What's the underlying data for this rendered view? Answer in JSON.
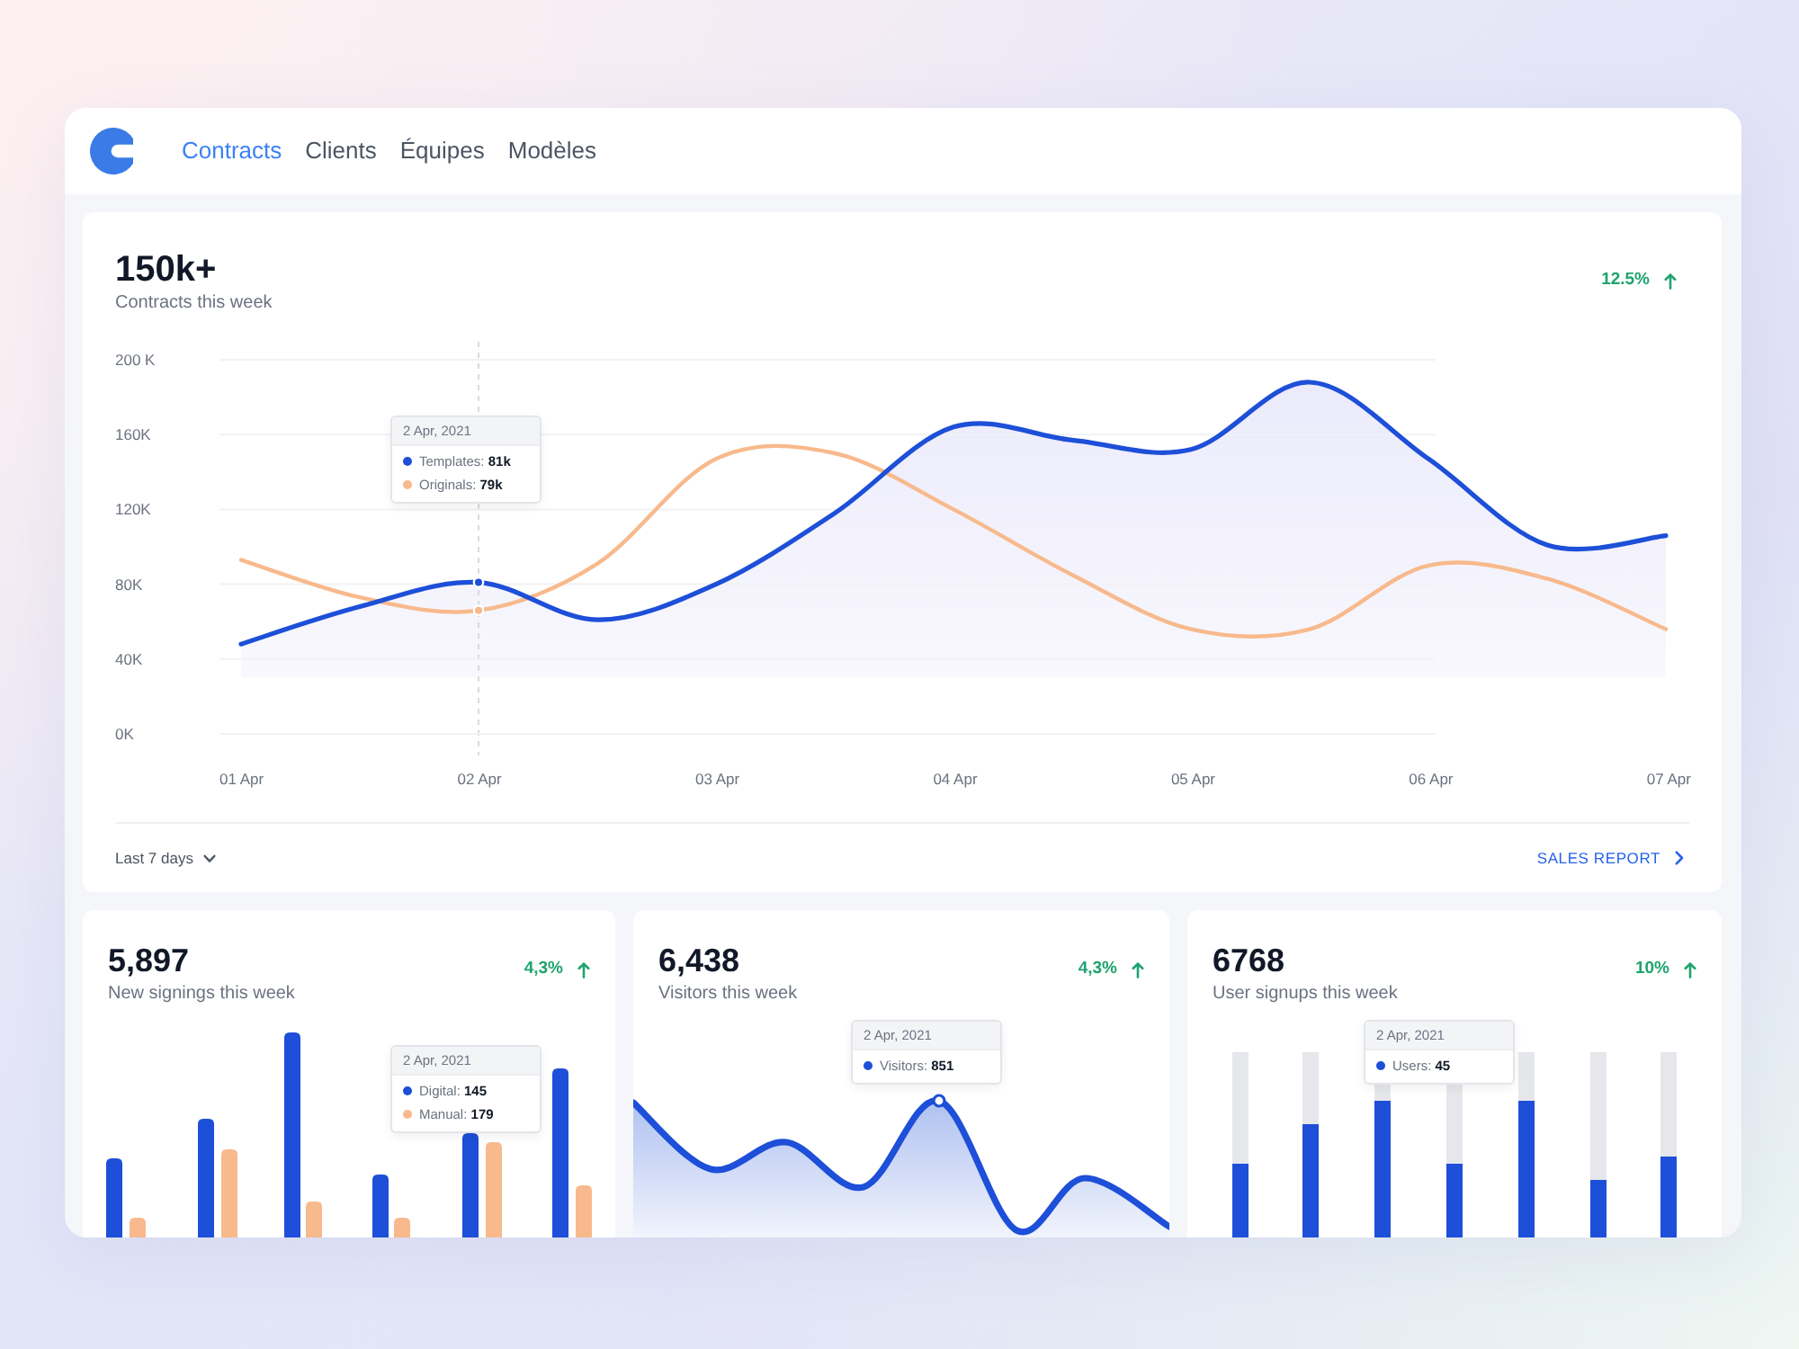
{
  "nav": {
    "tabs": [
      {
        "label": "Contracts",
        "selected": true
      },
      {
        "label": "Clients",
        "selected": false
      },
      {
        "label": "Équipes",
        "selected": false
      },
      {
        "label": "Modèles",
        "selected": false
      }
    ]
  },
  "summary": {
    "value": "150k+",
    "label": "Contracts this week",
    "trend": {
      "value": "12.5%",
      "up": true
    },
    "chart_data": {
      "type": "line",
      "grid": true,
      "categories": [
        "01 Apr",
        null,
        "02 Apr",
        null,
        "03 Apr",
        null,
        "04 Apr",
        null,
        "05 Apr",
        null,
        "06 Apr",
        null,
        "07 Apr"
      ],
      "ylim": [
        0,
        200
      ],
      "yticks": [
        {
          "value": 200,
          "label": "200 K"
        },
        {
          "value": 160,
          "label": "160K"
        },
        {
          "value": 120,
          "label": "120K"
        },
        {
          "value": 80,
          "label": "80K"
        },
        {
          "value": 40,
          "label": "40K"
        },
        {
          "value": 0,
          "label": "0K"
        }
      ],
      "series": [
        {
          "color": "#1d4fd8",
          "values": [
            48,
            68,
            81,
            61,
            80,
            118,
            164,
            157,
            152,
            188,
            147,
            101,
            106
          ]
        },
        {
          "color": "#f8b98c",
          "values": [
            93,
            73,
            66,
            91,
            147,
            150,
            120,
            85,
            56,
            56,
            90,
            83,
            56
          ]
        }
      ]
    },
    "tooltip": {
      "title": "2 Apr, 2021",
      "items": [
        {
          "text": "Templates: **81k**",
          "color": "#1d4fd8"
        },
        {
          "text": "Originals: **79k**",
          "color": "#f8b98c"
        }
      ]
    },
    "period": "Last 7 days",
    "report_link": "SALES REPORT"
  },
  "cards": [
    {
      "kind": "grouped_bars",
      "value": "5,897",
      "label": "New signings this week",
      "trend": {
        "value": "4,3%",
        "up": true
      },
      "tooltip": {
        "title": "2 Apr, 2021",
        "items": [
          {
            "text": "Digital: **145**",
            "color": "#1d4fd8"
          },
          {
            "text": "Manual: **179**",
            "color": "#f8b98c"
          }
        ]
      }
    },
    {
      "kind": "area",
      "value": "6,438",
      "label": "Visitors this week",
      "trend": {
        "value": "4,3%",
        "up": true
      },
      "tooltip": {
        "title": "2 Apr, 2021",
        "items": [
          {
            "text": "Visitors: **851**",
            "color": "#1d4fd8"
          }
        ]
      }
    },
    {
      "kind": "track_bars",
      "value": "6768",
      "label": "User signups this week",
      "trend": {
        "value": "10%",
        "up": true
      },
      "tooltip": {
        "title": "2 Apr, 2021",
        "items": [
          {
            "text": "Users: **45**",
            "color": "#1d4fd8"
          }
        ]
      }
    }
  ]
}
